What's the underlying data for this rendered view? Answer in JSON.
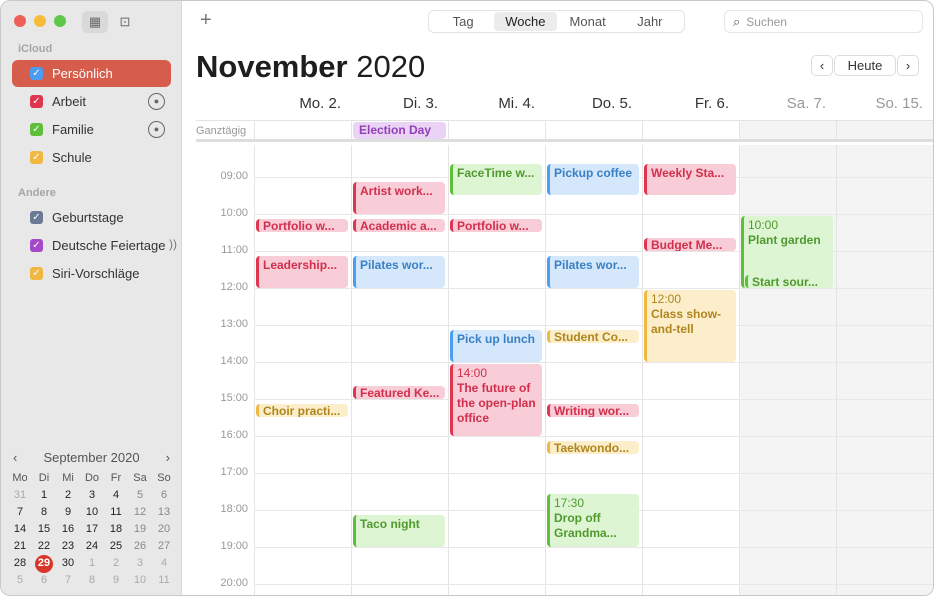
{
  "window": {
    "controls": [
      "close",
      "minimize",
      "zoom"
    ]
  },
  "toolbar": {
    "add_label": "+",
    "views": [
      "Tag",
      "Woche",
      "Monat",
      "Jahr"
    ],
    "active_view": "Woche",
    "search_placeholder": "Suchen"
  },
  "sidebar": {
    "sections": [
      {
        "title": "iCloud",
        "items": [
          {
            "label": "Persönlich",
            "color": "#4a9df0",
            "selected": true
          },
          {
            "label": "Arbeit",
            "color": "#e0354f",
            "shared": true
          },
          {
            "label": "Familie",
            "color": "#5fbf3a",
            "shared": true
          },
          {
            "label": "Schule",
            "color": "#f0b840"
          }
        ]
      },
      {
        "title": "Andere",
        "items": [
          {
            "label": "Geburtstage",
            "color": "#6d7a94"
          },
          {
            "label": "Deutsche Feiertage",
            "color": "#a449c9",
            "subscribed": true
          },
          {
            "label": "Siri-Vorschläge",
            "color": "#f0b840"
          }
        ]
      }
    ]
  },
  "mini_calendar": {
    "title": "September 2020",
    "prev": "‹",
    "next": "›",
    "weekdays": [
      "Mo",
      "Di",
      "Mi",
      "Do",
      "Fr",
      "Sa",
      "So"
    ],
    "weeks": [
      [
        "31",
        "1",
        "2",
        "3",
        "4",
        "5",
        "6"
      ],
      [
        "7",
        "8",
        "9",
        "10",
        "11",
        "12",
        "13"
      ],
      [
        "14",
        "15",
        "16",
        "17",
        "18",
        "19",
        "20"
      ],
      [
        "21",
        "22",
        "23",
        "24",
        "25",
        "26",
        "27"
      ],
      [
        "28",
        "29",
        "30",
        "1",
        "2",
        "3",
        "4"
      ],
      [
        "5",
        "6",
        "7",
        "8",
        "9",
        "10",
        "11"
      ]
    ],
    "today": "29"
  },
  "header": {
    "month": "November",
    "year": "2020",
    "prev": "‹",
    "today_button": "Heute",
    "next": "›"
  },
  "days": [
    "Mo. 2.",
    "Di. 3.",
    "Mi. 4.",
    "Do. 5.",
    "Fr. 6.",
    "Sa. 7.",
    "So. 15."
  ],
  "weekend_days": [
    5,
    6
  ],
  "all_day": {
    "label": "Ganztägig",
    "events": [
      {
        "day": 1,
        "title": "Election Day",
        "calendar": "purple"
      }
    ]
  },
  "hours": [
    "09:00",
    "10:00",
    "11:00",
    "12:00",
    "13:00",
    "14:00",
    "15:00",
    "16:00",
    "17:00",
    "18:00",
    "19:00",
    "20:00"
  ],
  "calendar_colors": {
    "red": {
      "bar": "#e0354f",
      "bg": "#f8cdd8",
      "text": "#d12f4b"
    },
    "blue": {
      "bar": "#4a9df0",
      "bg": "#d5e8fb",
      "text": "#3a80c4"
    },
    "green": {
      "bar": "#5fbf3a",
      "bg": "#def5d4",
      "text": "#4f9a2e"
    },
    "yellow": {
      "bar": "#f0b840",
      "bg": "#fdeecb",
      "text": "#ae861c"
    },
    "purple": {
      "bar": "#a449c9",
      "bg": "#ead3f4",
      "text": "#9240b6"
    }
  },
  "events": [
    {
      "day": 0,
      "start": "10:05",
      "end": "10:30",
      "title": "Portfolio w...",
      "calendar": "red"
    },
    {
      "day": 0,
      "start": "11:05",
      "end": "12:00",
      "title": "Leadership...",
      "calendar": "red"
    },
    {
      "day": 0,
      "start": "15:05",
      "end": "15:30",
      "title": "Choir practi...",
      "calendar": "yellow"
    },
    {
      "day": 1,
      "start": "09:05",
      "end": "10:00",
      "title": "Artist work...",
      "calendar": "red"
    },
    {
      "day": 1,
      "start": "10:05",
      "end": "10:30",
      "title": "Academic a...",
      "calendar": "red"
    },
    {
      "day": 1,
      "start": "11:05",
      "end": "12:00",
      "title": "Pilates wor...",
      "calendar": "blue"
    },
    {
      "day": 1,
      "start": "14:35",
      "end": "15:00",
      "title": "Featured Ke...",
      "calendar": "red"
    },
    {
      "day": 1,
      "start": "18:05",
      "end": "19:00",
      "title": "Taco night",
      "calendar": "green"
    },
    {
      "day": 2,
      "start": "08:35",
      "end": "09:30",
      "title": "FaceTime w...",
      "calendar": "green"
    },
    {
      "day": 2,
      "start": "10:05",
      "end": "10:30",
      "title": "Portfolio w...",
      "calendar": "red"
    },
    {
      "day": 2,
      "start": "13:05",
      "end": "14:00",
      "title": "Pick up lunch",
      "calendar": "blue"
    },
    {
      "day": 2,
      "start": "14:00",
      "end": "16:00",
      "time": "14:00",
      "title": "The future of the open-plan office",
      "calendar": "red",
      "wrap": true
    },
    {
      "day": 3,
      "start": "08:35",
      "end": "09:30",
      "title": "Pickup coffee",
      "calendar": "blue"
    },
    {
      "day": 3,
      "start": "11:05",
      "end": "12:00",
      "title": "Pilates wor...",
      "calendar": "blue"
    },
    {
      "day": 3,
      "start": "13:05",
      "end": "13:30",
      "title": "Student Co...",
      "calendar": "yellow"
    },
    {
      "day": 3,
      "start": "15:05",
      "end": "15:30",
      "title": "Writing wor...",
      "calendar": "red"
    },
    {
      "day": 3,
      "start": "16:05",
      "end": "16:30",
      "title": "Taekwondo...",
      "calendar": "yellow"
    },
    {
      "day": 3,
      "start": "17:30",
      "end": "19:00",
      "time": "17:30",
      "title": "Drop off Grandma...",
      "calendar": "green",
      "wrap": true
    },
    {
      "day": 4,
      "start": "08:35",
      "end": "09:30",
      "title": "Weekly Sta...",
      "calendar": "red"
    },
    {
      "day": 4,
      "start": "10:35",
      "end": "11:00",
      "title": "Budget Me...",
      "calendar": "red"
    },
    {
      "day": 4,
      "start": "12:00",
      "end": "14:00",
      "time": "12:00",
      "title": "Class show-and-tell",
      "calendar": "yellow",
      "wrap": true
    },
    {
      "day": 5,
      "start": "10:00",
      "end": "12:00",
      "time": "10:00",
      "title": "Plant garden",
      "calendar": "green",
      "wrap": true
    },
    {
      "day": 5,
      "start": "11:35",
      "end": "12:00",
      "title": "Start sour...",
      "calendar": "green",
      "inset": true
    }
  ]
}
